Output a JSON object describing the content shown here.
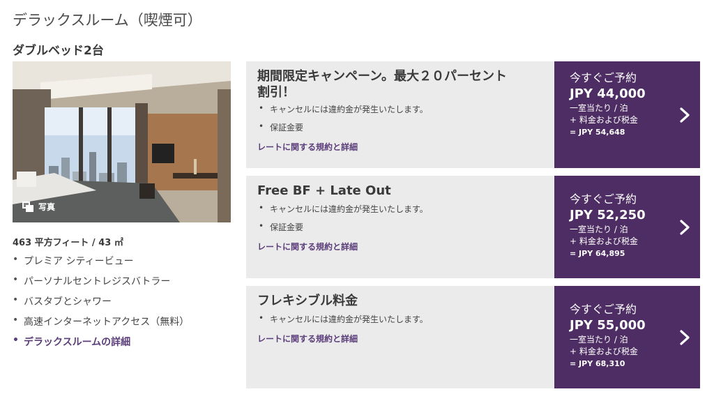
{
  "room": {
    "title": "デラックスルーム（喫煙可）",
    "bed_type": "ダブルベッド2台",
    "photo_label": "写真",
    "size": "463 平方フィート / 43 ㎡",
    "amenities": [
      "プレミア シティービュー",
      "パーソナルセントレジスバトラー",
      "バスタブとシャワー",
      "高速インターネットアクセス（無料）"
    ],
    "details_link": "デラックスルームの詳細"
  },
  "rates": [
    {
      "name_line1": "期間限定キャンペーン。最大２０パーセント",
      "name_line2": "割引！",
      "bullets": [
        "キャンセルには違約金が発生いたします。",
        "保証金要"
      ],
      "link": "レートに関する規約と詳細",
      "cta": "今すぐご予約",
      "price": "JPY 44,000",
      "per": "一室当たり / 泊",
      "tax": "+ 料金および税金",
      "total": "= JPY 54,648"
    },
    {
      "name_line1": "Free BF + Late Out",
      "name_line2": "",
      "bullets": [
        "キャンセルには違約金が発生いたします。",
        "保証金要"
      ],
      "link": "レートに関する規約と詳細",
      "cta": "今すぐご予約",
      "price": "JPY 52,250",
      "per": "一室当たり / 泊",
      "tax": "+ 料金および税金",
      "total": "= JPY 64,895"
    },
    {
      "name_line1": "フレキシブル料金",
      "name_line2": "",
      "bullets": [
        "キャンセルには違約金が発生いたします。"
      ],
      "link": "レートに関する規約と詳細",
      "cta": "今すぐご予約",
      "price": "JPY 55,000",
      "per": "一室当たり / 泊",
      "tax": "+ 料金および税金",
      "total": "= JPY 68,310"
    }
  ],
  "colors": {
    "accent_purple": "#4d2d63",
    "link_purple": "#5b3d7a",
    "card_bg": "#ebebeb"
  },
  "icons": {
    "photo": "photo-gallery-icon",
    "chevron": "chevron-right-icon"
  }
}
